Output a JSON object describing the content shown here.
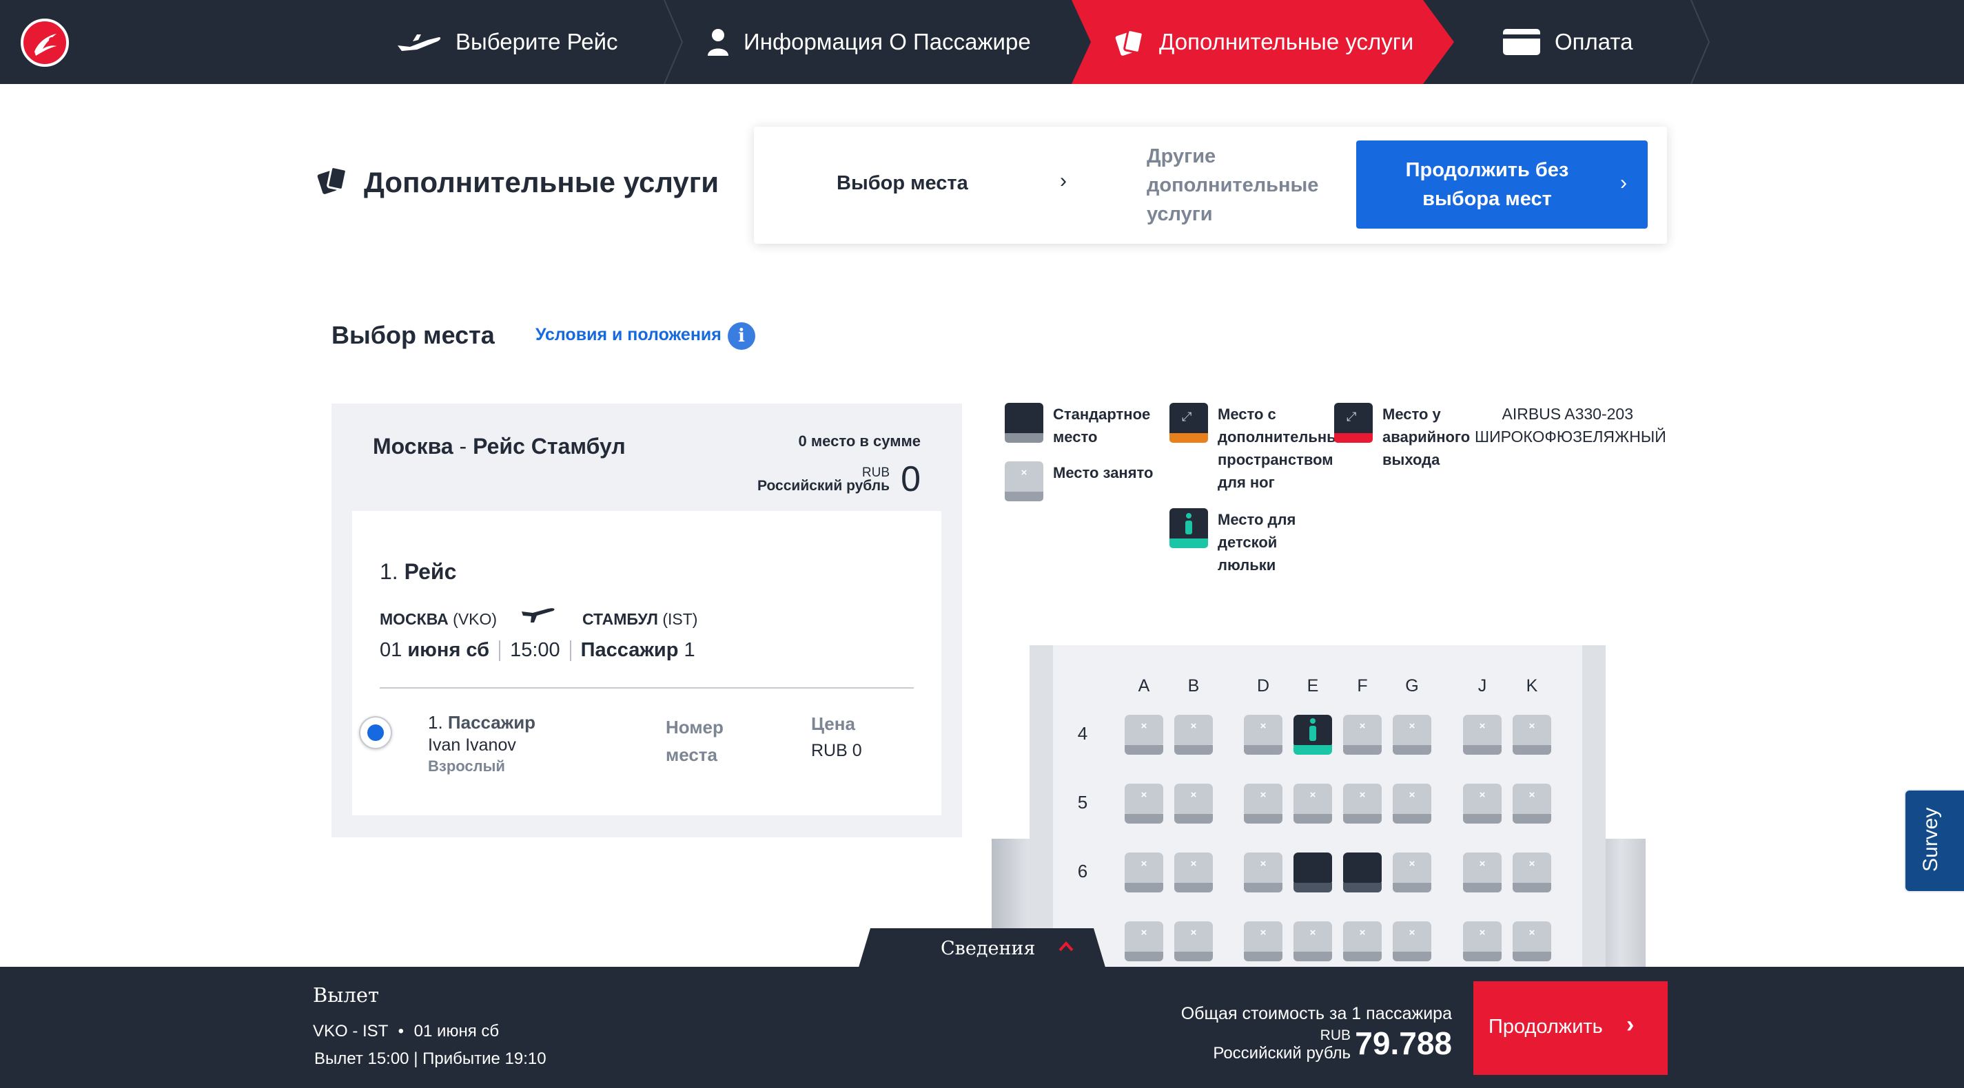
{
  "nav": {
    "steps": [
      {
        "label": "Выберите Рейс",
        "icon": "plane-icon"
      },
      {
        "label": "Информация О Пассажире",
        "icon": "person-icon"
      },
      {
        "label": "Дополнительные услуги",
        "icon": "cards-icon",
        "active": true
      },
      {
        "label": "Оплата",
        "icon": "card-icon"
      }
    ],
    "active_color": "#e81932",
    "bar_color": "#232b38"
  },
  "header": {
    "title": "Дополнительные услуги",
    "stepper": {
      "step1": "Выбор места",
      "step2": "Другие дополнительные услуги",
      "skip_button": "Продолжить без выбора мест"
    }
  },
  "seat_section": {
    "title": "Выбор места",
    "terms_link": "Условия и положения",
    "info_icon": "i"
  },
  "flight": {
    "route_from": "Москва",
    "route_sep": " - ",
    "route_to": "Рейс Стамбул",
    "seats_summary": "0 место в сумме",
    "currency_code": "RUB",
    "currency_name": "Российский рубль",
    "total": "0",
    "flight_no": "1.",
    "flight_title": "Рейс",
    "origin_city": "МОСКВА",
    "origin_code": "(VKO)",
    "dest_city": "СТАМБУЛ",
    "dest_code": "(IST)",
    "date_prefix": "01",
    "date_rest": "июня сб",
    "time": "15:00",
    "passenger_label": "Пассажир",
    "passenger_count": "1",
    "pax_no": "1.",
    "pax_label": "Пассажир",
    "pax_name": "Ivan Ivanov",
    "pax_type": "Взрослый",
    "seat_no_label": "Номер места",
    "price_label": "Цена",
    "price_value": "RUB  0"
  },
  "legend": {
    "standard": "Стандартное место",
    "occupied": "Место занято",
    "extra_legroom": "Место с дополнительным пространством для ног",
    "baby_bassinet": "Место для детской люльки",
    "emergency_exit": "Место у аварийного выхода",
    "aircraft": "AIRBUS A330-203 ШИРОКОФЮЗЕЛЯЖНЫЙ"
  },
  "seatmap": {
    "columns": [
      "A",
      "B",
      "D",
      "E",
      "F",
      "G",
      "J",
      "K"
    ],
    "rows": [
      {
        "row": "4",
        "seats": [
          "occupied",
          "occupied",
          "occupied",
          "baby",
          "occupied",
          "occupied",
          "occupied",
          "occupied"
        ]
      },
      {
        "row": "5",
        "seats": [
          "occupied",
          "occupied",
          "occupied",
          "occupied",
          "occupied",
          "occupied",
          "occupied",
          "occupied"
        ]
      },
      {
        "row": "6",
        "seats": [
          "occupied",
          "occupied",
          "occupied",
          "available",
          "available",
          "occupied",
          "occupied",
          "occupied"
        ]
      },
      {
        "row": "",
        "seats": [
          "occupied",
          "occupied",
          "occupied",
          "occupied",
          "occupied",
          "occupied",
          "occupied",
          "occupied"
        ]
      }
    ]
  },
  "details_tab": "Сведения",
  "footer": {
    "departure_title": "Вылет",
    "route": "VKO - IST",
    "bullet": "•",
    "date": "01 июня сб",
    "times": "Вылет 15:00 | Прибытие 19:10",
    "total_label": "Общая стоимость за 1 пассажира",
    "currency_code": "RUB",
    "currency_name": "Российский рубль",
    "total_value": "79.788",
    "continue_button": "Продолжить"
  },
  "survey": "Survey"
}
